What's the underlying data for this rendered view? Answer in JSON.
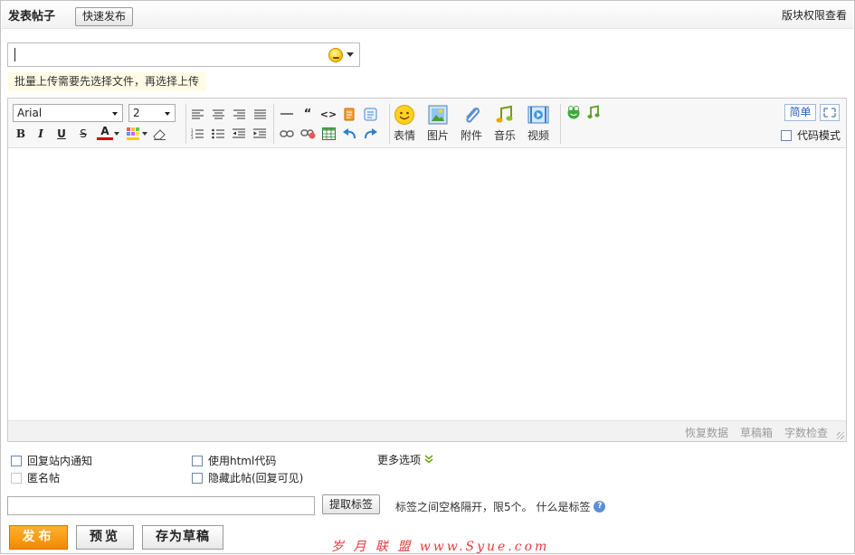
{
  "header": {
    "title": "发表帖子",
    "quick_publish_label": "快速发布",
    "permission_link": "版块权限查看"
  },
  "subject": {
    "value": "",
    "emoji_icon": "smiley-icon"
  },
  "upload_tip": "批量上传需要先选择文件，再选择上传",
  "toolbar": {
    "font_family": "Arial",
    "font_size": "2",
    "big_buttons": [
      {
        "label": "表情",
        "icon": "smiley-icon"
      },
      {
        "label": "图片",
        "icon": "image-icon"
      },
      {
        "label": "附件",
        "icon": "paperclip-icon"
      },
      {
        "label": "音乐",
        "icon": "music-icon"
      },
      {
        "label": "视频",
        "icon": "video-icon"
      }
    ],
    "simple_label": "简单",
    "code_mode_label": "代码模式"
  },
  "statusbar": {
    "restore_label": "恢复数据",
    "drafts_label": "草稿箱",
    "wordcount_label": "字数检查"
  },
  "options": {
    "reply_notify": "回复站内通知",
    "use_html": "使用html代码",
    "more_options": "更多选项",
    "anonymous": "匿名帖",
    "hide_post": "隐藏此帖(回复可见)"
  },
  "tags": {
    "value": "",
    "fetch_label": "提取标签",
    "help_text": "标签之间空格隔开，限5个。 什么是标签",
    "help_icon": "question-icon"
  },
  "actions": {
    "publish_label": "发布",
    "preview_label": "预览",
    "draft_label": "存为草稿"
  },
  "watermark": "岁 月 联 盟 www.Syue.com"
}
